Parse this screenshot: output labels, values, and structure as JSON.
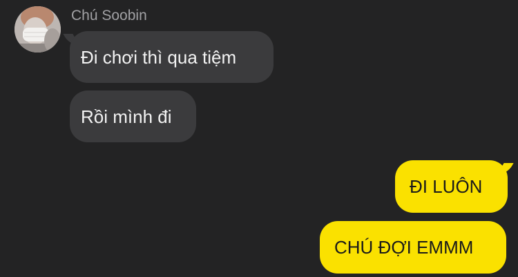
{
  "conversation": {
    "contact": {
      "name": "Chú Soobin",
      "avatar_icon": "profile-photo"
    },
    "incoming_messages": [
      {
        "text": "Đi chơi thì qua tiệm"
      },
      {
        "text": "Rồi mình đi"
      }
    ],
    "outgoing_messages": [
      {
        "text": "ĐI LUÔN"
      },
      {
        "text": "CHÚ ĐỢI EMMM"
      }
    ]
  },
  "colors": {
    "background": "#232324",
    "incoming_bubble": "#3b3b3d",
    "outgoing_bubble": "#fae100",
    "sender_name": "#a2a2a5"
  }
}
